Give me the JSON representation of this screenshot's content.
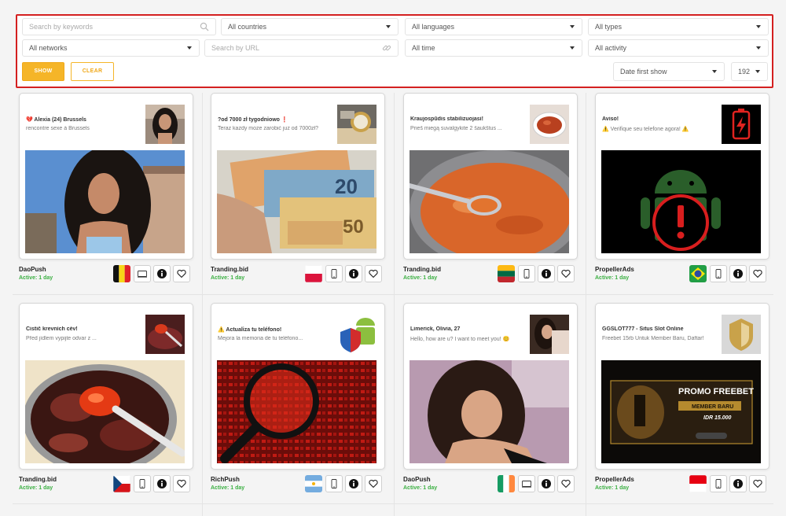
{
  "filters": {
    "keywords_placeholder": "Search by keywords",
    "countries": "All countries",
    "languages": "All languages",
    "types": "All types",
    "networks": "All networks",
    "url_placeholder": "Search by URL",
    "time": "All time",
    "activity": "All activity",
    "show_label": "SHOW",
    "clear_label": "CLEAR",
    "sort": "Date first show",
    "per_page": "192"
  },
  "ads": [
    {
      "title": "💔 Alexia (24) Brussels",
      "body": "rencontre sexe à Brussels",
      "network": "DaoPush",
      "active": "Active: 1 day",
      "flag": "belgium",
      "device": "desktop"
    },
    {
      "title": "?od 7000 zł tygodniowo ❗",
      "body": "Teraz każdy może zarobić już od 7000zł?",
      "network": "Tranding.bid",
      "active": "Active: 1 day",
      "flag": "poland",
      "device": "mobile"
    },
    {
      "title": "Kraujospūdis stabilizuojasi!",
      "body": "Prieš miegą suvalgykite 2 šaukštus ...",
      "network": "Tranding.bid",
      "active": "Active: 1 day",
      "flag": "lithuania",
      "device": "mobile"
    },
    {
      "title": "Aviso!",
      "body": "⚠️ Verifique seu telefone agora! ⚠️",
      "network": "PropellerAds",
      "active": "Active: 1 day",
      "flag": "brazil",
      "device": "mobile"
    },
    {
      "title": "Čistič krevních cév!",
      "body": "Před jídlem vypijte odvar z ...",
      "network": "Tranding.bid",
      "active": "Active: 1 day",
      "flag": "czech",
      "device": "mobile"
    },
    {
      "title": "⚠️ Actualiza tu teléfono!",
      "body": "Mejora la memoria de tu teléfono...",
      "network": "RichPush",
      "active": "Active: 1 day",
      "flag": "argentina",
      "device": "mobile"
    },
    {
      "title": "Limerick, Olivia, 27",
      "body": "Hello, how are u? I want to meet you! 😊",
      "network": "DaoPush",
      "active": "Active: 1 day",
      "flag": "ireland",
      "device": "desktop"
    },
    {
      "title": "GGSLOT777 - Situs Slot Online",
      "body": "Freebet 15rb Untuk Member Baru, Daftar!",
      "network": "PropellerAds",
      "active": "Active: 1 day",
      "flag": "indonesia",
      "device": "mobile"
    }
  ],
  "banner": {
    "l1": "PROMO FREEBET",
    "l2": "MEMBER BARU",
    "l3": "IDR 15.000"
  },
  "icons": {
    "info": "info-icon",
    "favorite": "heart-icon",
    "search": "search-icon",
    "link": "link-icon"
  },
  "colors": {
    "accent": "#f5b528",
    "frame": "#d42020",
    "active": "#3cb043"
  }
}
